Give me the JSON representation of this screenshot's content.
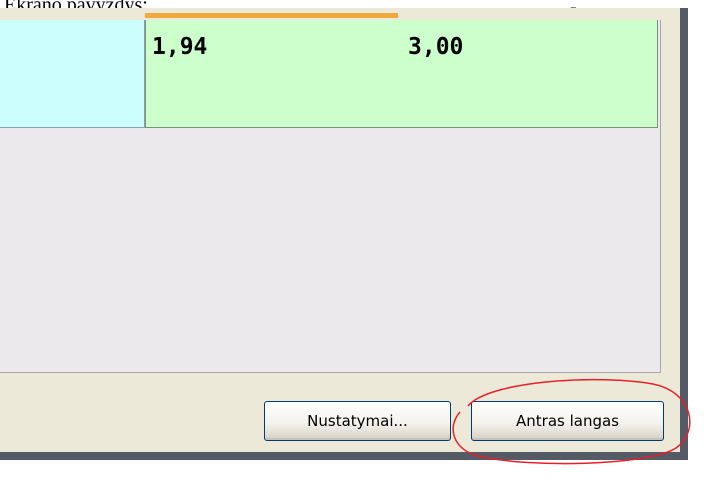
{
  "document": {
    "text": "Ekrano pavyzdys:",
    "dash": "-"
  },
  "grid": {
    "rows": [
      {
        "cells": [
          "",
          "1,94",
          "3,00"
        ]
      }
    ]
  },
  "buttons": {
    "settings_label": "Nustatymai...",
    "second_window_label": "Antras langas"
  },
  "colors": {
    "cell_cyan": "#ccfefe",
    "cell_green": "#ccffcc",
    "window_bg": "#ece9d8",
    "tab_accent": "#f2a93b",
    "annotation": "#e8202a"
  },
  "annotation": {
    "type": "ellipse",
    "target": "second-window-button"
  }
}
